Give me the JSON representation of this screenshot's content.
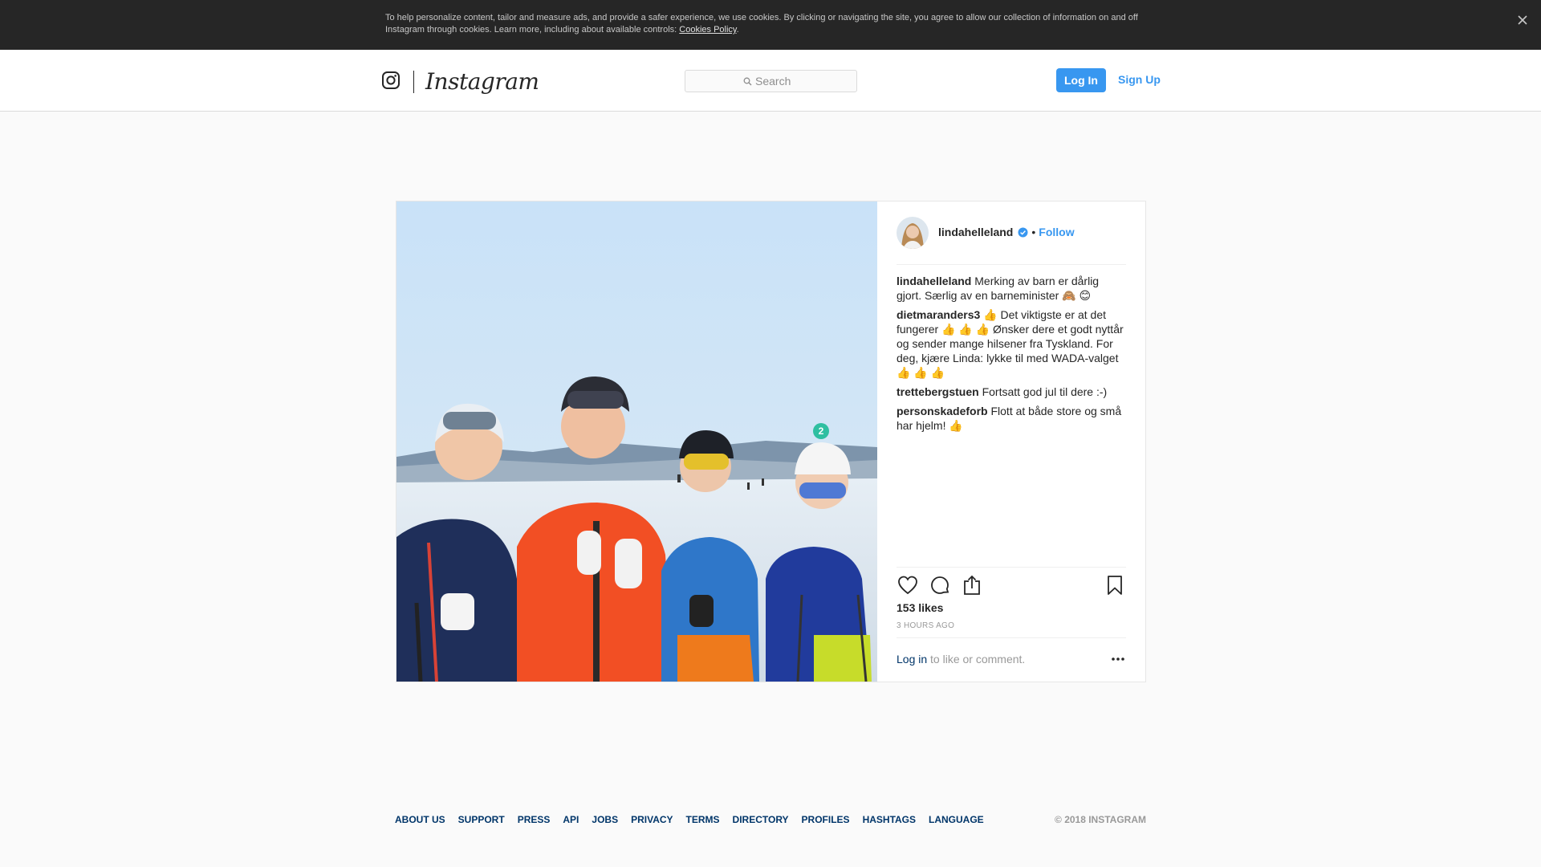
{
  "cookie_banner": {
    "text": "To help personalize content, tailor and measure ads, and provide a safer experience, we use cookies. By clicking or navigating the site, you agree to allow our collection of information on and off Instagram through cookies. Learn more, including about available controls: ",
    "link": "Cookies Policy",
    "suffix": "."
  },
  "header": {
    "brand": "Instagram",
    "search_placeholder": "Search",
    "login_label": "Log In",
    "signup_label": "Sign Up"
  },
  "post": {
    "author": "lindahelleland",
    "follow_separator": "•",
    "follow_label": "Follow",
    "photo_badge": "2",
    "comments": [
      {
        "user": "lindahelleland",
        "text": "Merking av barn er dårlig gjort. Særlig av en barneminister 🙈 😊"
      },
      {
        "user": "dietmaranders3",
        "text": "👍 Det viktigste er at det fungerer 👍 👍 👍  Ønsker dere et godt nyttår og sender mange hilsener fra Tyskland. For deg, kjære Linda: lykke til med WADA-valget 👍 👍 👍"
      },
      {
        "user": "trettebergstuen",
        "text": "Fortsatt god jul til dere :-)"
      },
      {
        "user": "personskadeforb",
        "text": "Flott at både store og små har hjelm! 👍"
      }
    ],
    "likes": "153 likes",
    "timestamp": "3 HOURS AGO",
    "login_link": "Log in",
    "login_suffix": " to like or comment."
  },
  "icons": {
    "close": "close-icon",
    "instagram_glyph": "instagram-glyph-icon",
    "search": "search-icon",
    "verified": "verified-badge-icon",
    "like": "heart-icon",
    "comment": "comment-bubble-icon",
    "share": "share-icon",
    "save": "bookmark-icon",
    "more": "more-options-icon"
  },
  "colors": {
    "accent": "#3897f0",
    "banner_bg": "#262626",
    "link_dark": "#003569",
    "muted": "#999999"
  },
  "footer": {
    "links": [
      "ABOUT US",
      "SUPPORT",
      "PRESS",
      "API",
      "JOBS",
      "PRIVACY",
      "TERMS",
      "DIRECTORY",
      "PROFILES",
      "HASHTAGS",
      "LANGUAGE"
    ],
    "copyright": "© 2018 INSTAGRAM"
  }
}
